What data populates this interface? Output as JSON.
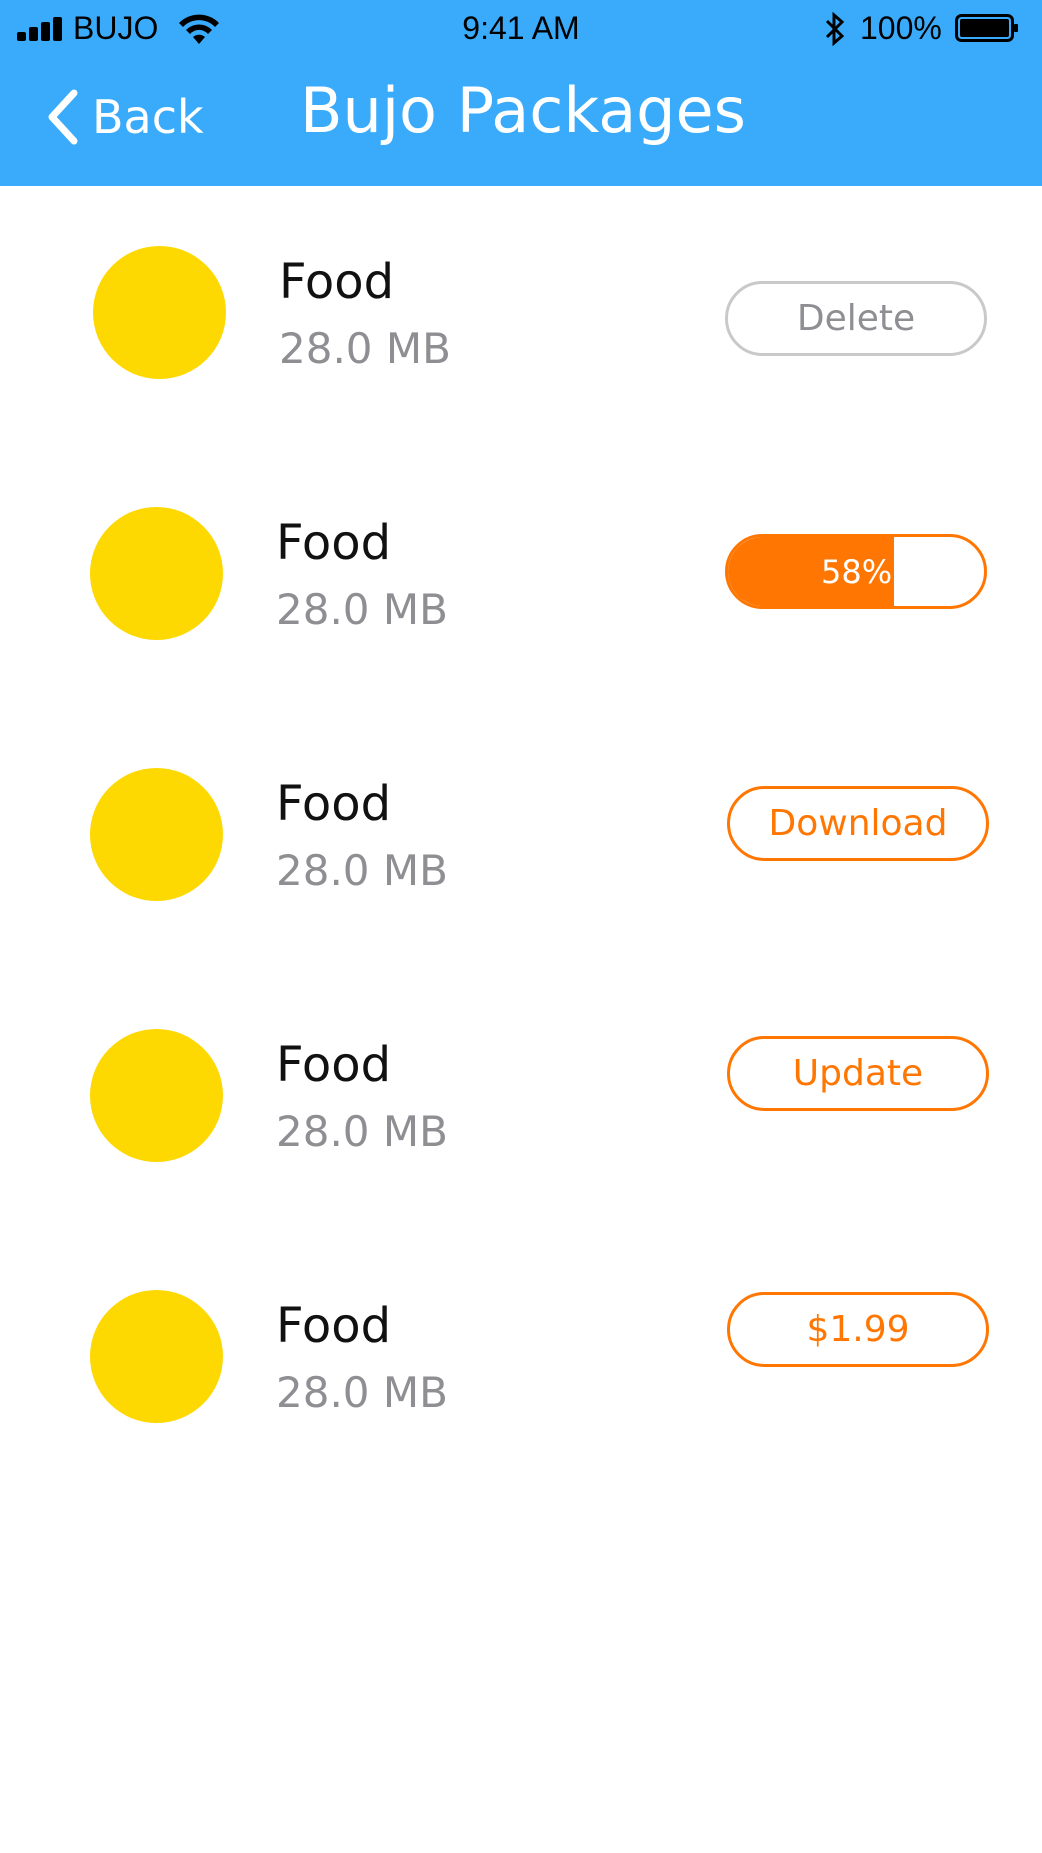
{
  "status_bar": {
    "carrier": "BUJO",
    "time": "9:41 AM",
    "battery": "100%"
  },
  "nav": {
    "back_label": "Back",
    "title": "Bujo Packages"
  },
  "packages": [
    {
      "name": "Food",
      "size": "28.0 MB",
      "action": "Delete",
      "style": "gray"
    },
    {
      "name": "Food",
      "size": "28.0 MB",
      "action": "58%",
      "style": "progress",
      "progress": 0.58
    },
    {
      "name": "Food",
      "size": "28.0 MB",
      "action": "Download",
      "style": "orange"
    },
    {
      "name": "Food",
      "size": "28.0 MB",
      "action": "Update",
      "style": "orange"
    },
    {
      "name": "Food",
      "size": "28.0 MB",
      "action": "$1.99",
      "style": "orange"
    }
  ],
  "colors": {
    "header": "#3aabfb",
    "accent": "#ff7702",
    "icon": "#fed801",
    "secondary_text": "#8e8e93"
  }
}
